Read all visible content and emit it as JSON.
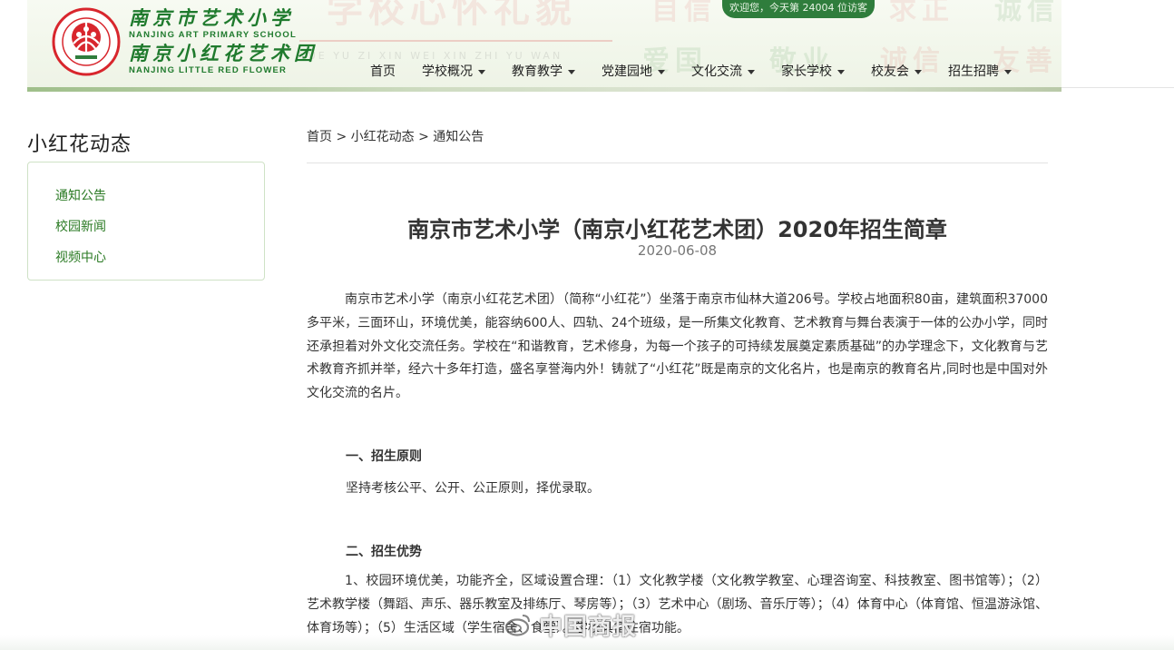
{
  "header": {
    "bg_slogans_top": [
      "学校心怀礼貌",
      "自信",
      "求正",
      "诚信"
    ],
    "bg_slogans_bottom": [
      "爱国",
      "敬业",
      "诚信",
      "友善"
    ],
    "bg_pinyin": "YUE YU ZI XIN WEI XIN ZHI YU WAN",
    "school_name_cn_1": "南京市艺术小学",
    "school_name_en_1": "NANJING ART PRIMARY SCHOOL",
    "school_name_cn_2": "南京小红花艺术团",
    "school_name_en_2": "NANJING LITTLE RED FLOWER",
    "visitor_text": "欢迎您，今天第 24004 位访客",
    "nav": [
      {
        "label": "首页",
        "dropdown": false
      },
      {
        "label": "学校概况",
        "dropdown": true
      },
      {
        "label": "教育教学",
        "dropdown": true
      },
      {
        "label": "党建园地",
        "dropdown": true
      },
      {
        "label": "文化交流",
        "dropdown": true
      },
      {
        "label": "家长学校",
        "dropdown": true
      },
      {
        "label": "校友会",
        "dropdown": true
      },
      {
        "label": "招生招聘",
        "dropdown": true
      }
    ]
  },
  "sidebar": {
    "title": "小红花动态",
    "items": [
      {
        "label": "通知公告"
      },
      {
        "label": "校园新闻"
      },
      {
        "label": "视频中心"
      }
    ]
  },
  "breadcrumb": {
    "items": [
      "首页",
      "小红花动态",
      "通知公告"
    ],
    "separator": ">"
  },
  "article": {
    "title": "南京市艺术小学（南京小红花艺术团）2020年招生简章",
    "date": "2020-06-08",
    "intro": "南京市艺术小学（南京小红花艺术团）（简称“小红花”）坐落于南京市仙林大道206号。学校占地面积80亩，建筑面积37000多平米，三面环山，环境优美，能容纳600人、四轨、24个班级，是一所集文化教育、艺术教育与舞台表演于一体的公办小学，同时还承担着对外文化交流任务。学校在“和谐教育，艺术修身，为每一个孩子的可持续发展奠定素质基础”的办学理念下，文化教育与艺术教育齐抓并举，经六十多年打造，盛名享誉海内外！铸就了“小红花”既是南京的文化名片，也是南京的教育名片,同时也是中国对外文化交流的名片。",
    "section1_title": "一、招生原则",
    "section1_body": "坚持考核公平、公开、公正原则，择优录取。",
    "section2_title": "二、招生优势",
    "section2_body": "1、校园环境优美，功能齐全，区域设置合理：（1）文化教学楼（文化教学教室、心理咨询室、科技教室、图书馆等）；（2）艺术教学楼（舞蹈、声乐、器乐教室及排练厅、琴房等）；（3）艺术中心（剧场、音乐厅等）；（4）体育中心（体育馆、恒温游泳馆、体育场等）；（5）生活区域（学生宿舍、食堂）。学校具备住宿功能。"
  },
  "watermark": {
    "text": "中国商报",
    "icon": "weibo-icon"
  },
  "colors": {
    "brand_green": "#1f7a2d",
    "link_green": "#2a7a23",
    "logo_red": "#d8262d",
    "pill_green": "#2f7d3c"
  }
}
